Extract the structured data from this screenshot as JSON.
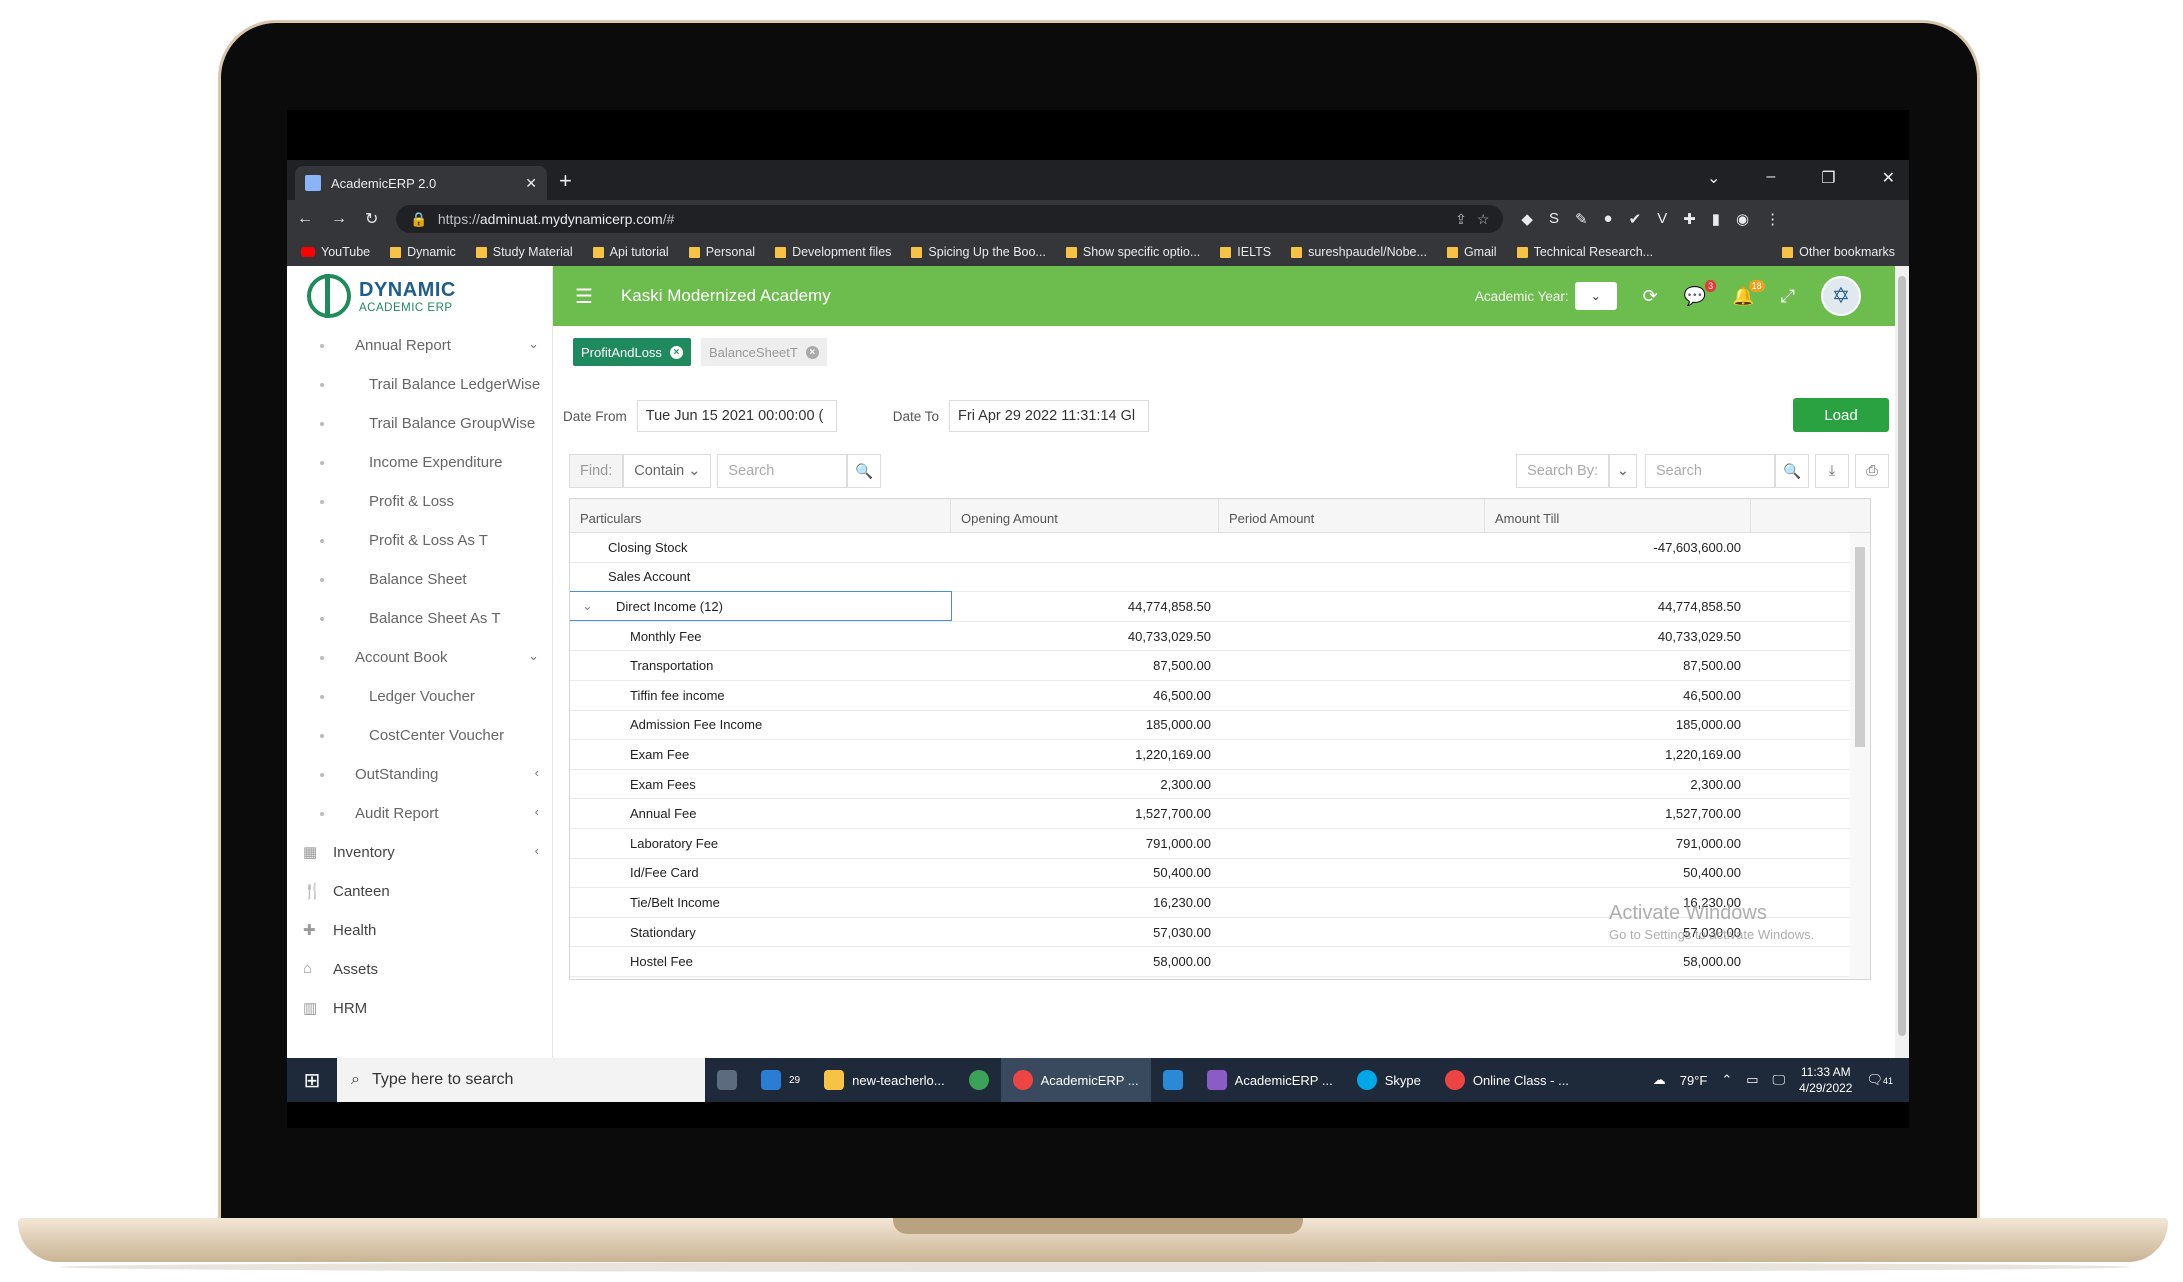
{
  "browser": {
    "tab_title": "AcademicERP 2.0",
    "new_tab": "+",
    "url_prefix": "https://",
    "url_host": "adminuat.mydynamicerp.com",
    "url_path": "/#",
    "bookmarks": [
      "YouTube",
      "Dynamic",
      "Study Material",
      "Api tutorial",
      "Personal",
      "Development files",
      "Spicing Up the Boo...",
      "Show specific optio...",
      "IELTS",
      "sureshpaudel/Nobe...",
      "Gmail",
      "Technical Research..."
    ],
    "other_bookmarks": "Other bookmarks"
  },
  "logo": {
    "line1": "DYNAMIC",
    "line2": "ACADEMIC ERP"
  },
  "sidebar": {
    "items": [
      {
        "label": "Annual Report",
        "level": "lvl1",
        "caret": "⌄"
      },
      {
        "label": "Trail Balance LedgerWise",
        "level": "lvl2"
      },
      {
        "label": "Trail Balance GroupWise",
        "level": "lvl2"
      },
      {
        "label": "Income Expenditure",
        "level": "lvl2"
      },
      {
        "label": "Profit & Loss",
        "level": "lvl2"
      },
      {
        "label": "Profit & Loss As T",
        "level": "lvl2"
      },
      {
        "label": "Balance Sheet",
        "level": "lvl2"
      },
      {
        "label": "Balance Sheet As T",
        "level": "lvl2"
      },
      {
        "label": "Account Book",
        "level": "lvl1",
        "caret": "⌄"
      },
      {
        "label": "Ledger Voucher",
        "level": "lvl2"
      },
      {
        "label": "CostCenter Voucher",
        "level": "lvl2"
      },
      {
        "label": "OutStanding",
        "level": "lvl1",
        "caret": "‹"
      },
      {
        "label": "Audit Report",
        "level": "lvl1",
        "caret": "‹"
      },
      {
        "label": "Inventory",
        "level": "lvl0",
        "caret": "‹"
      },
      {
        "label": "Canteen",
        "level": "lvl0"
      },
      {
        "label": "Health",
        "level": "lvl0"
      },
      {
        "label": "Assets",
        "level": "lvl0"
      },
      {
        "label": "HRM",
        "level": "lvl0"
      }
    ]
  },
  "topbar": {
    "title": "Kaski Modernized Academy",
    "academic_year_label": "Academic Year:",
    "messages_badge": "3",
    "notifications_badge": "18"
  },
  "chips": [
    {
      "label": "ProfitAndLoss",
      "active": true
    },
    {
      "label": "BalanceSheetT",
      "active": false
    }
  ],
  "filters": {
    "date_from_label": "Date From",
    "date_from": "Tue Jun 15 2021 00:00:00 (",
    "date_to_label": "Date To",
    "date_to": "Fri Apr 29 2022 11:31:14 Gl",
    "load_button": "Load",
    "find_label": "Find:",
    "find_mode": "Contain",
    "search_placeholder": "Search",
    "search_by_label": "Search By:",
    "search_placeholder_2": "Search"
  },
  "table": {
    "columns": [
      "Particulars",
      "Opening Amount",
      "Period Amount",
      "Amount Till"
    ],
    "rows": [
      {
        "name": "Closing Stock",
        "indent": 1,
        "opening": "",
        "period": "",
        "till": "-47,603,600.00"
      },
      {
        "name": "Sales Account",
        "indent": 1,
        "opening": "",
        "period": "",
        "till": ""
      },
      {
        "name": "Direct Income  (12)",
        "indent": 2,
        "opening": "44,774,858.50",
        "period": "",
        "till": "44,774,858.50",
        "expander": "⌄"
      },
      {
        "name": "Monthly Fee",
        "indent": 3,
        "opening": "40,733,029.50",
        "period": "",
        "till": "40,733,029.50"
      },
      {
        "name": "Transportation",
        "indent": 3,
        "opening": "87,500.00",
        "period": "",
        "till": "87,500.00"
      },
      {
        "name": "Tiffin fee income",
        "indent": 3,
        "opening": "46,500.00",
        "period": "",
        "till": "46,500.00"
      },
      {
        "name": "Admission Fee Income",
        "indent": 3,
        "opening": "185,000.00",
        "period": "",
        "till": "185,000.00"
      },
      {
        "name": "Exam Fee",
        "indent": 3,
        "opening": "1,220,169.00",
        "period": "",
        "till": "1,220,169.00"
      },
      {
        "name": "Exam Fees",
        "indent": 3,
        "opening": "2,300.00",
        "period": "",
        "till": "2,300.00"
      },
      {
        "name": "Annual Fee",
        "indent": 3,
        "opening": "1,527,700.00",
        "period": "",
        "till": "1,527,700.00"
      },
      {
        "name": "Laboratory Fee",
        "indent": 3,
        "opening": "791,000.00",
        "period": "",
        "till": "791,000.00"
      },
      {
        "name": "Id/Fee Card",
        "indent": 3,
        "opening": "50,400.00",
        "period": "",
        "till": "50,400.00"
      },
      {
        "name": "Tie/Belt Income",
        "indent": 3,
        "opening": "16,230.00",
        "period": "",
        "till": "16,230.00"
      },
      {
        "name": "Stationdary",
        "indent": 3,
        "opening": "57,030.00",
        "period": "",
        "till": "57,030.00"
      },
      {
        "name": "Hostel Fee",
        "indent": 3,
        "opening": "58,000.00",
        "period": "",
        "till": "58,000.00"
      }
    ]
  },
  "watermark": {
    "title": "Activate Windows",
    "subtitle": "Go to Settings to activate Windows."
  },
  "taskbar": {
    "search_placeholder": "Type here to search",
    "mail_badge": "29",
    "apps": [
      "new-teacherlo...",
      "AcademicERP ...",
      "AcademicERP ...",
      "Skype",
      "Online Class - ..."
    ],
    "weather": "79°F",
    "time": "11:33 AM",
    "date": "4/29/2022",
    "notif_count": "41"
  }
}
